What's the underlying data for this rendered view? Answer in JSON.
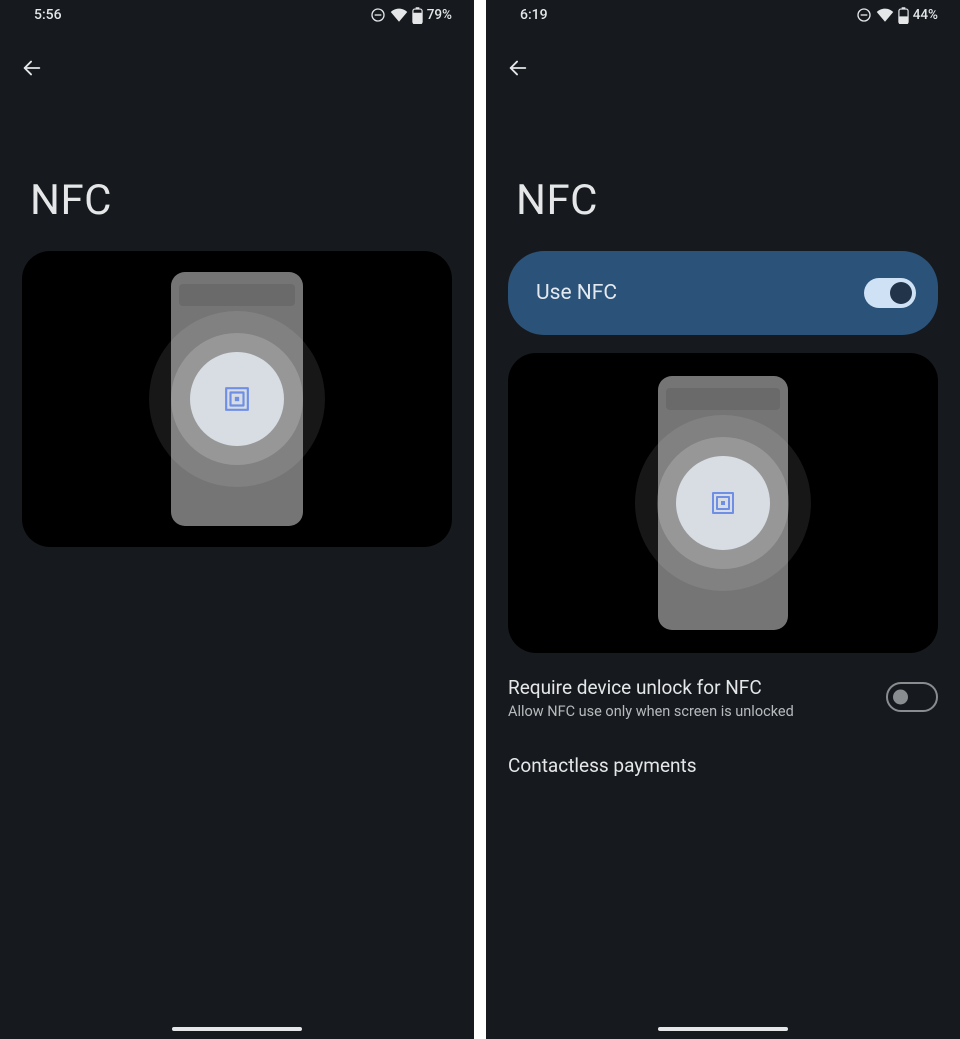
{
  "left": {
    "status": {
      "time": "5:56",
      "battery": "79%"
    },
    "title": "NFC"
  },
  "right": {
    "status": {
      "time": "6:19",
      "battery": "44%"
    },
    "title": "NFC",
    "use_nfc": {
      "label": "Use NFC",
      "enabled": true
    },
    "require_unlock": {
      "title": "Require device unlock for NFC",
      "subtitle": "Allow NFC use only when screen is unlocked",
      "enabled": false
    },
    "contactless": {
      "label": "Contactless payments"
    }
  }
}
